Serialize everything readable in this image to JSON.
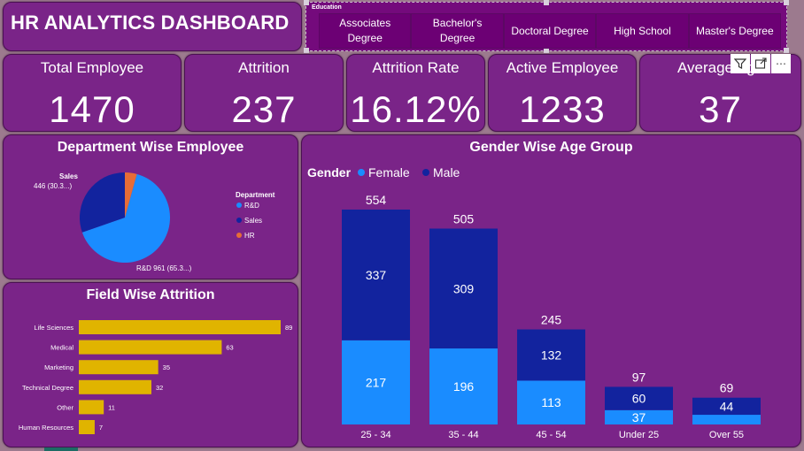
{
  "header": {
    "title": "HR ANALYTICS DASHBOARD"
  },
  "slicer": {
    "title": "Education",
    "items": [
      "Associates Degree",
      "Bachelor's Degree",
      "Doctoral Degree",
      "High School",
      "Master's Degree"
    ]
  },
  "kpis": [
    {
      "label": "Total Employee",
      "value": "1470"
    },
    {
      "label": "Attrition",
      "value": "237"
    },
    {
      "label": "Attrition Rate",
      "value": "16.12%"
    },
    {
      "label": "Active Employee",
      "value": "1233"
    },
    {
      "label": "Average Age",
      "value": "37"
    }
  ],
  "toolbar": {
    "filter_icon": "filter-icon",
    "focus_icon": "focus-mode-icon",
    "more_icon": "more-options-icon",
    "more_glyph": "⋯"
  },
  "colors": {
    "card_bg": "#7a2488",
    "female": "#1a8cff",
    "male": "#12239e",
    "hr": "#e66c37",
    "bar": "#e0b400"
  },
  "chart_data": [
    {
      "type": "pie",
      "title": "Department Wise Employee",
      "legend_title": "Department",
      "legend_position": "right",
      "slices": [
        {
          "name": "R&D",
          "value": 961,
          "label": "R&D 961 (65.3...)",
          "color": "#1a8cff"
        },
        {
          "name": "Sales",
          "value": 446,
          "label_name": "Sales",
          "label_value": "446 (30.3...)",
          "color": "#12239e"
        },
        {
          "name": "HR",
          "value": 63,
          "color": "#e66c37"
        }
      ]
    },
    {
      "type": "bar",
      "orientation": "horizontal",
      "title": "Field Wise Attrition",
      "categories": [
        "Life Sciences",
        "Medical",
        "Marketing",
        "Technical Degree",
        "Other",
        "Human Resources"
      ],
      "values": [
        89,
        63,
        35,
        32,
        11,
        7
      ],
      "color": "#e0b400"
    },
    {
      "type": "bar",
      "stacked": true,
      "title": "Gender Wise Age Group",
      "legend_title": "Gender",
      "legend_position": "top-left",
      "categories": [
        "25 - 34",
        "35 - 44",
        "45 - 54",
        "Under 25",
        "Over 55"
      ],
      "series": [
        {
          "name": "Female",
          "values": [
            217,
            196,
            113,
            37,
            25
          ],
          "labels": [
            "217",
            "196",
            "113",
            "37",
            ""
          ],
          "color": "#1a8cff"
        },
        {
          "name": "Male",
          "values": [
            337,
            309,
            132,
            60,
            44
          ],
          "labels": [
            "337",
            "309",
            "132",
            "60",
            "44"
          ],
          "color": "#12239e"
        }
      ],
      "totals": [
        554,
        505,
        245,
        97,
        69
      ],
      "ylim": [
        0,
        554
      ]
    }
  ]
}
